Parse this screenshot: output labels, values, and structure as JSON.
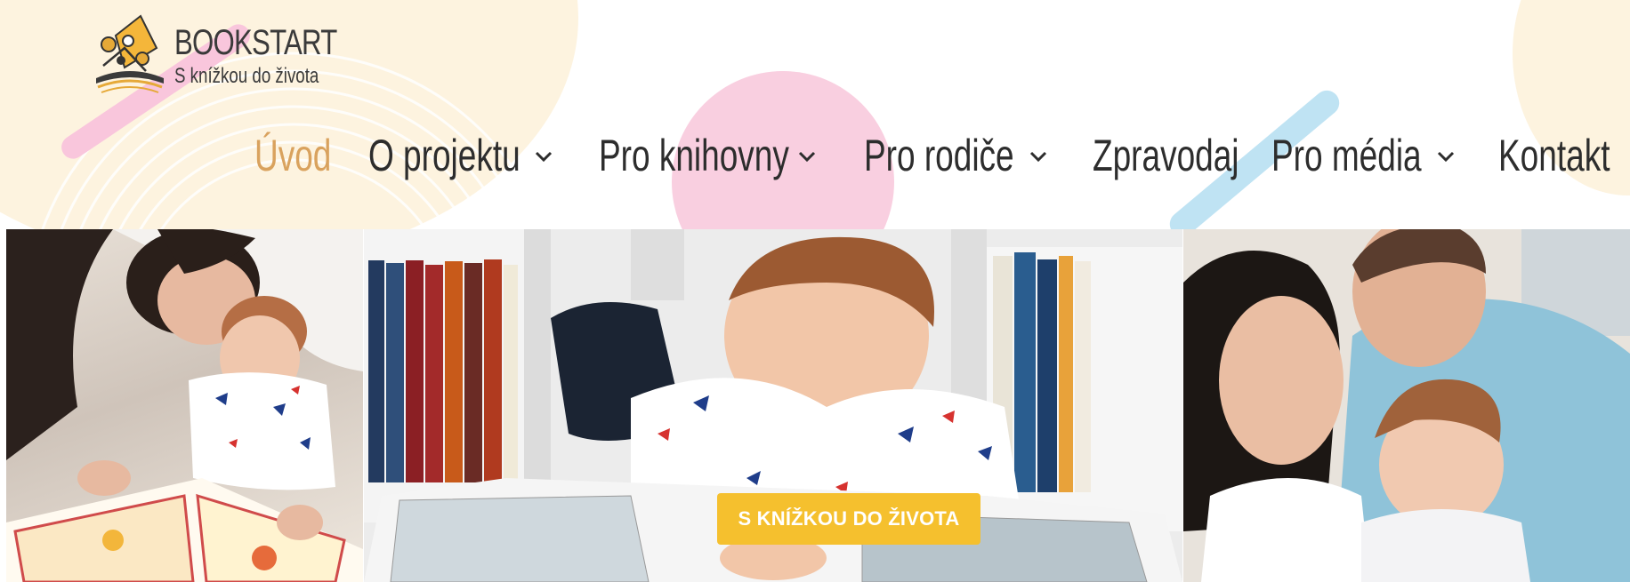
{
  "brand": {
    "title": "BOOKSTART",
    "subtitle": "S knížkou do života",
    "logo_icon": "book-with-people-icon"
  },
  "colors": {
    "accent": "#d9a25e",
    "cta": "#f5c02e",
    "text": "#2d2d2d",
    "pink": "#f9c6dc",
    "blue": "#bfe3f3",
    "cream": "#fdf3df"
  },
  "nav": {
    "items": [
      {
        "label": "Úvod",
        "active": true,
        "dropdown": false
      },
      {
        "label": "O projektu",
        "active": false,
        "dropdown": true
      },
      {
        "label": "Pro knihovny",
        "active": false,
        "dropdown": true
      },
      {
        "label": "Pro rodiče",
        "active": false,
        "dropdown": true
      },
      {
        "label": "Zpravodaj",
        "active": false,
        "dropdown": false
      },
      {
        "label": "Pro média",
        "active": false,
        "dropdown": true
      },
      {
        "label": "Kontakt",
        "active": false,
        "dropdown": false
      }
    ]
  },
  "hero": {
    "photos": [
      "mother-reading-with-baby-photo",
      "baby-reading-book-photo",
      "parents-with-baby-photo"
    ],
    "cta_label": "S KNÍŽKOU DO ŽIVOTA"
  }
}
